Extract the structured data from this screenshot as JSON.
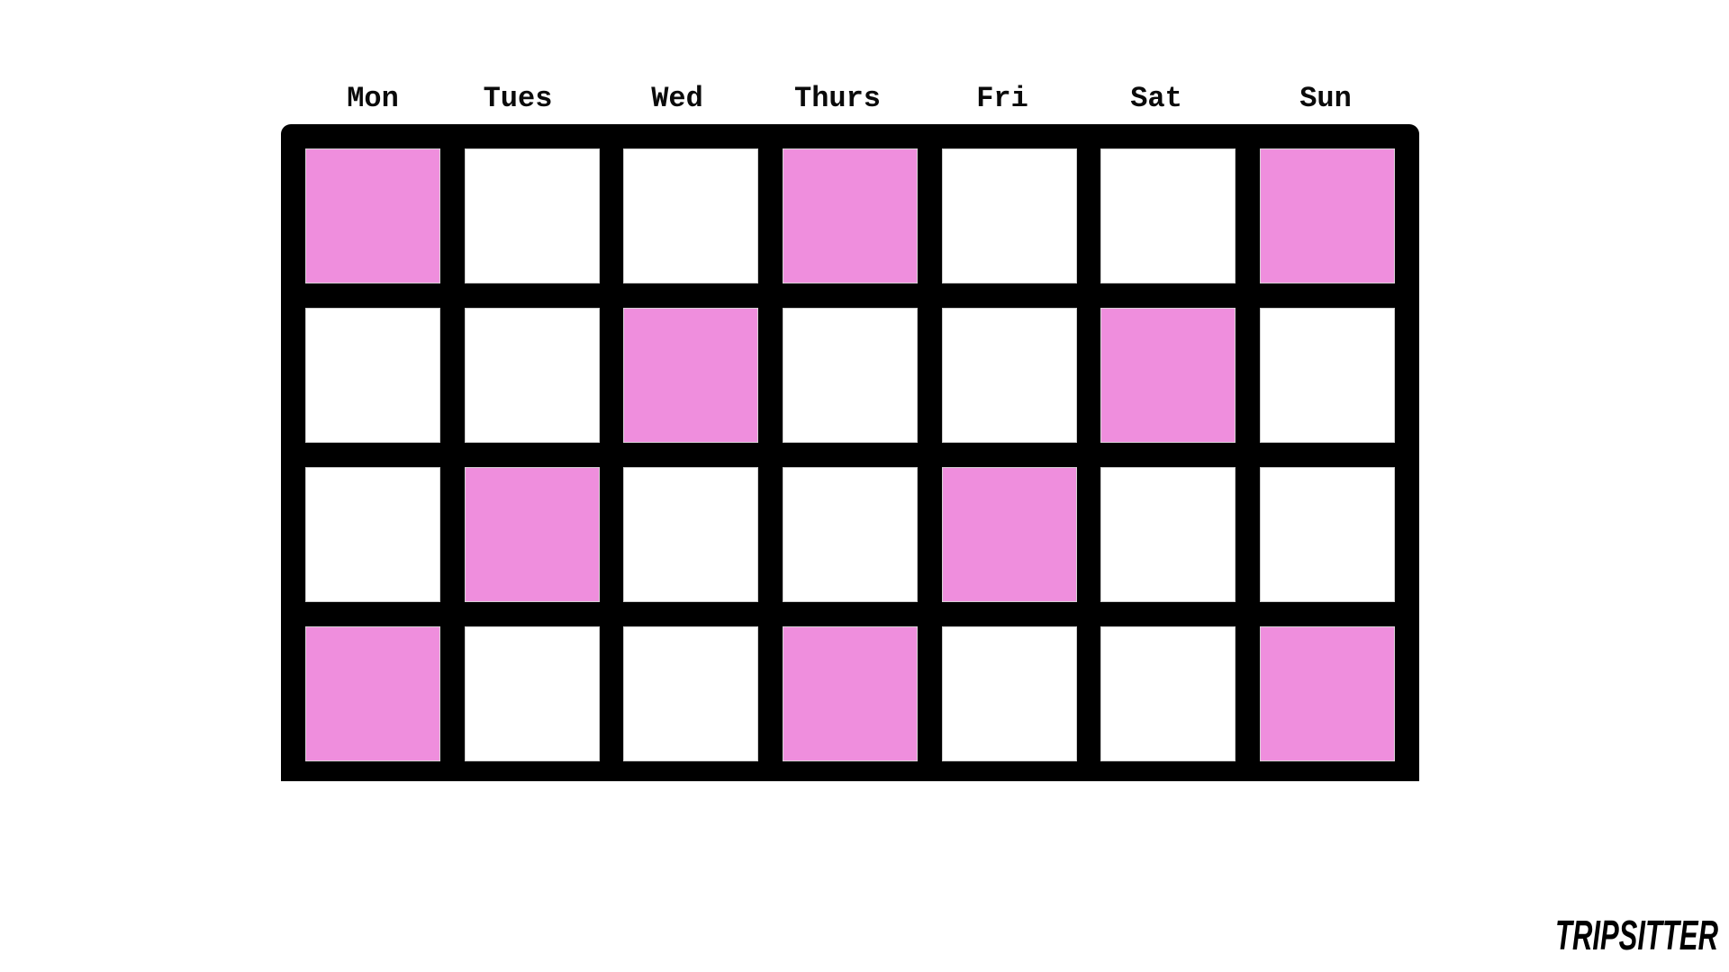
{
  "calendar": {
    "days": [
      "Mon",
      "Tues",
      "Wed",
      "Thurs",
      "Fri",
      "Sat",
      "Sun"
    ],
    "weeks": 4,
    "marked_color": "#ef8edd",
    "empty_color": "#ffffff",
    "grid_color": "#000000",
    "marked": [
      [
        true,
        false,
        false,
        true,
        false,
        false,
        true
      ],
      [
        false,
        false,
        true,
        false,
        false,
        true,
        false
      ],
      [
        false,
        true,
        false,
        false,
        true,
        false,
        false
      ],
      [
        true,
        false,
        false,
        true,
        false,
        false,
        true
      ]
    ]
  },
  "branding": {
    "logo_text": "TRIPSITTER"
  }
}
